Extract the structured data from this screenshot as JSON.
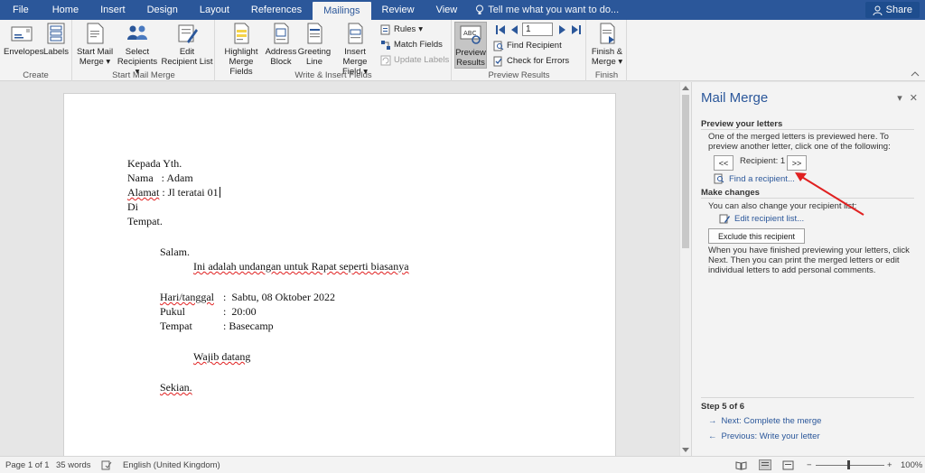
{
  "tabs": [
    "File",
    "Home",
    "Insert",
    "Design",
    "Layout",
    "References",
    "Mailings",
    "Review",
    "View"
  ],
  "active_tab": "Mailings",
  "tell_me": "Tell me what you want to do...",
  "share_label": "Share",
  "ribbon": {
    "create": {
      "label": "Create",
      "envelopes": "Envelopes",
      "labels": "Labels"
    },
    "start": {
      "label": "Start Mail Merge",
      "start_l1": "Start Mail",
      "start_l2": "Merge",
      "select_l1": "Select",
      "select_l2": "Recipients",
      "edit_l1": "Edit",
      "edit_l2": "Recipient List"
    },
    "write": {
      "label": "Write & Insert Fields",
      "highlight_l1": "Highlight",
      "highlight_l2": "Merge Fields",
      "address_l1": "Address",
      "address_l2": "Block",
      "greeting_l1": "Greeting",
      "greeting_l2": "Line",
      "insert_l1": "Insert Merge",
      "insert_l2": "Field",
      "rules": "Rules",
      "match": "Match Fields",
      "update": "Update Labels"
    },
    "preview": {
      "label": "Preview Results",
      "preview_l1": "Preview",
      "preview_l2": "Results",
      "record": "1",
      "find": "Find Recipient",
      "check": "Check for Errors"
    },
    "finish": {
      "label": "Finish",
      "finish_l1": "Finish &",
      "finish_l2": "Merge"
    }
  },
  "document": {
    "l1": "Kepada Yth.",
    "l2a": "Nama   : Adam",
    "l3a": "Alamat",
    "l3b": " : Jl teratai 01",
    "l4": "Di",
    "l5": "Tempat.",
    "salam": "Salam.",
    "intro": "Ini adalah undangan untuk Rapat seperti biasanya",
    "r1_label": "Hari/tanggal",
    "r1_value": ":  Sabtu, 08 Oktober 2022",
    "r2_label": "Pukul",
    "r2_value": ":  20:00",
    "r3_label": "Tempat",
    "r3_value": ": Basecamp",
    "wajib": "Wajib datang",
    "sekian": "Sekian."
  },
  "pane": {
    "title": "Mail Merge",
    "preview_head": "Preview your letters",
    "preview_text": "One of the merged letters is previewed here. To preview another letter, click one of the following:",
    "prev_btn": "<<",
    "recipient_label": "Recipient: 1",
    "next_btn": ">>",
    "find_link": "Find a recipient...",
    "changes_head": "Make changes",
    "changes_text": "You can also change your recipient list:",
    "edit_link": "Edit recipient list...",
    "exclude_btn": "Exclude this recipient",
    "finish_text": "When you have finished previewing your letters, click Next. Then you can print the merged letters or edit individual letters to add personal comments.",
    "step": "Step 5 of 6",
    "next_link": "Next: Complete the merge",
    "prev_link": "Previous: Write your letter"
  },
  "status": {
    "page": "Page 1 of 1",
    "words": "35 words",
    "language": "English (United Kingdom)",
    "zoom": "100%"
  },
  "colors": {
    "accent": "#2b579a",
    "arrow": "#e02020"
  }
}
